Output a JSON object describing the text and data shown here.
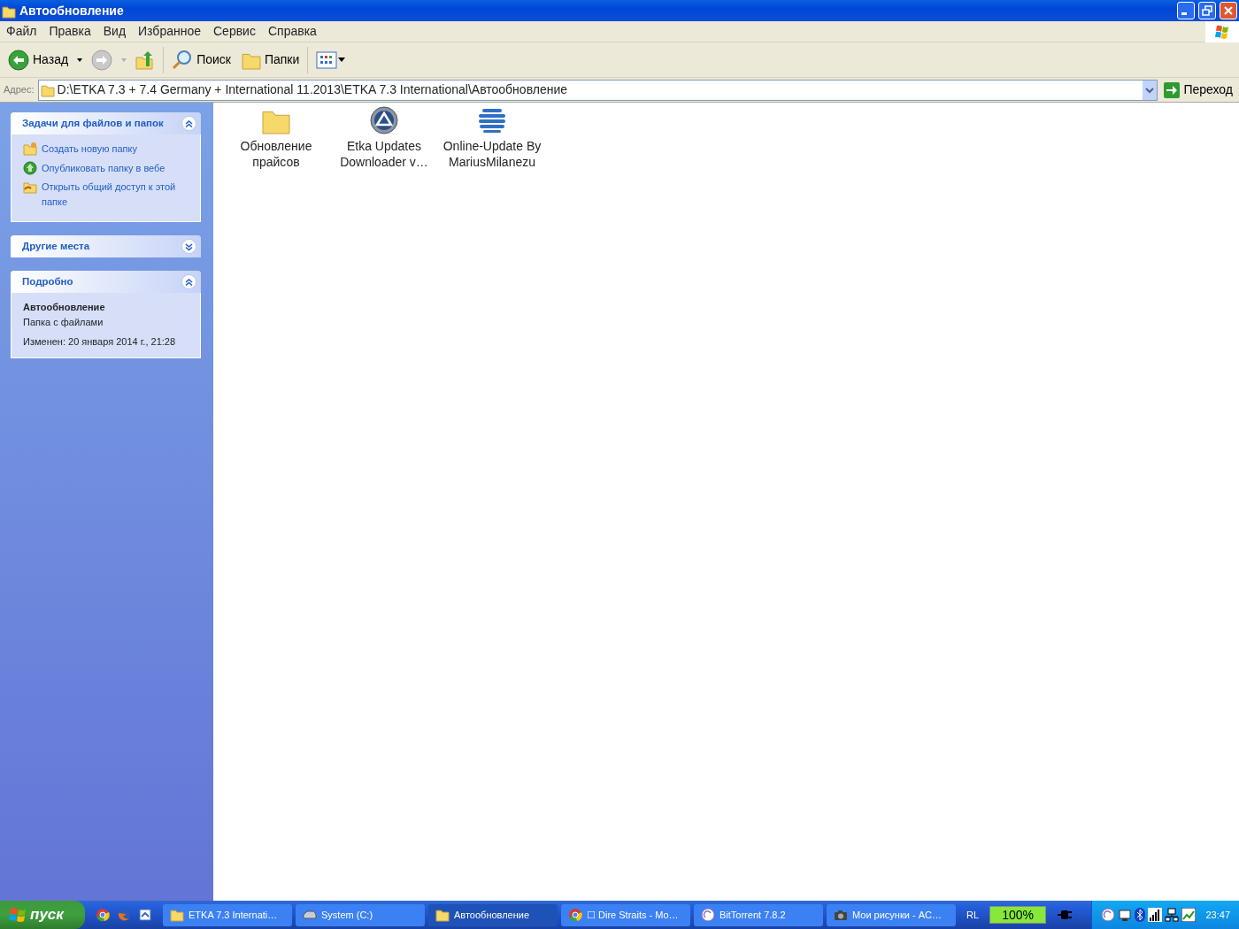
{
  "window": {
    "title": "Автообновление"
  },
  "menu": [
    "Файл",
    "Правка",
    "Вид",
    "Избранное",
    "Сервис",
    "Справка"
  ],
  "toolbar": {
    "back": "Назад",
    "search": "Поиск",
    "folders": "Папки"
  },
  "address": {
    "label": "Адрес:",
    "value": "D:\\ETKA 7.3 + 7.4 Germany + International 11.2013\\ETKA 7.3 International\\Автообновление",
    "go": "Переход"
  },
  "sidebar": [
    {
      "title": "Задачи для файлов и папок",
      "expanded": true,
      "kind": "tasks",
      "items": [
        {
          "label": "Создать новую папку",
          "kind": "new-folder"
        },
        {
          "label": "Опубликовать папку в вебе",
          "kind": "publish"
        },
        {
          "label": "Открыть общий доступ к этой папке",
          "kind": "share"
        }
      ]
    },
    {
      "title": "Другие места",
      "expanded": false
    },
    {
      "title": "Подробно",
      "expanded": true,
      "kind": "details",
      "details": {
        "name": "Автообновление",
        "type": "Папка с файлами",
        "modified": "Изменен: 20 января 2014 г., 21:28"
      }
    }
  ],
  "files": [
    {
      "name": "Обновление прайсов",
      "kind": "folder"
    },
    {
      "name": "Etka Updates Downloader v…",
      "kind": "round-logo"
    },
    {
      "name": "Online-Update By MariusMilanezu",
      "kind": "striped-globe"
    }
  ],
  "taskbar": {
    "start": "пуск",
    "buttons": [
      {
        "label": "ETKA 7.3 Internati…",
        "kind": "folder",
        "selected": false
      },
      {
        "label": "System (C:)",
        "kind": "drive",
        "selected": false
      },
      {
        "label": "Автообновление",
        "kind": "folder",
        "selected": true
      },
      {
        "label": "☐ Dire Straits - Mo…",
        "kind": "browser",
        "selected": false
      },
      {
        "label": "BitTorrent 7.8.2",
        "kind": "torrent",
        "selected": false
      },
      {
        "label": "Мои рисунки - AC…",
        "kind": "camera",
        "selected": false
      }
    ],
    "language": "RL",
    "battery": {
      "reading": "100%",
      "level": 1
    },
    "clock": "23:47"
  }
}
